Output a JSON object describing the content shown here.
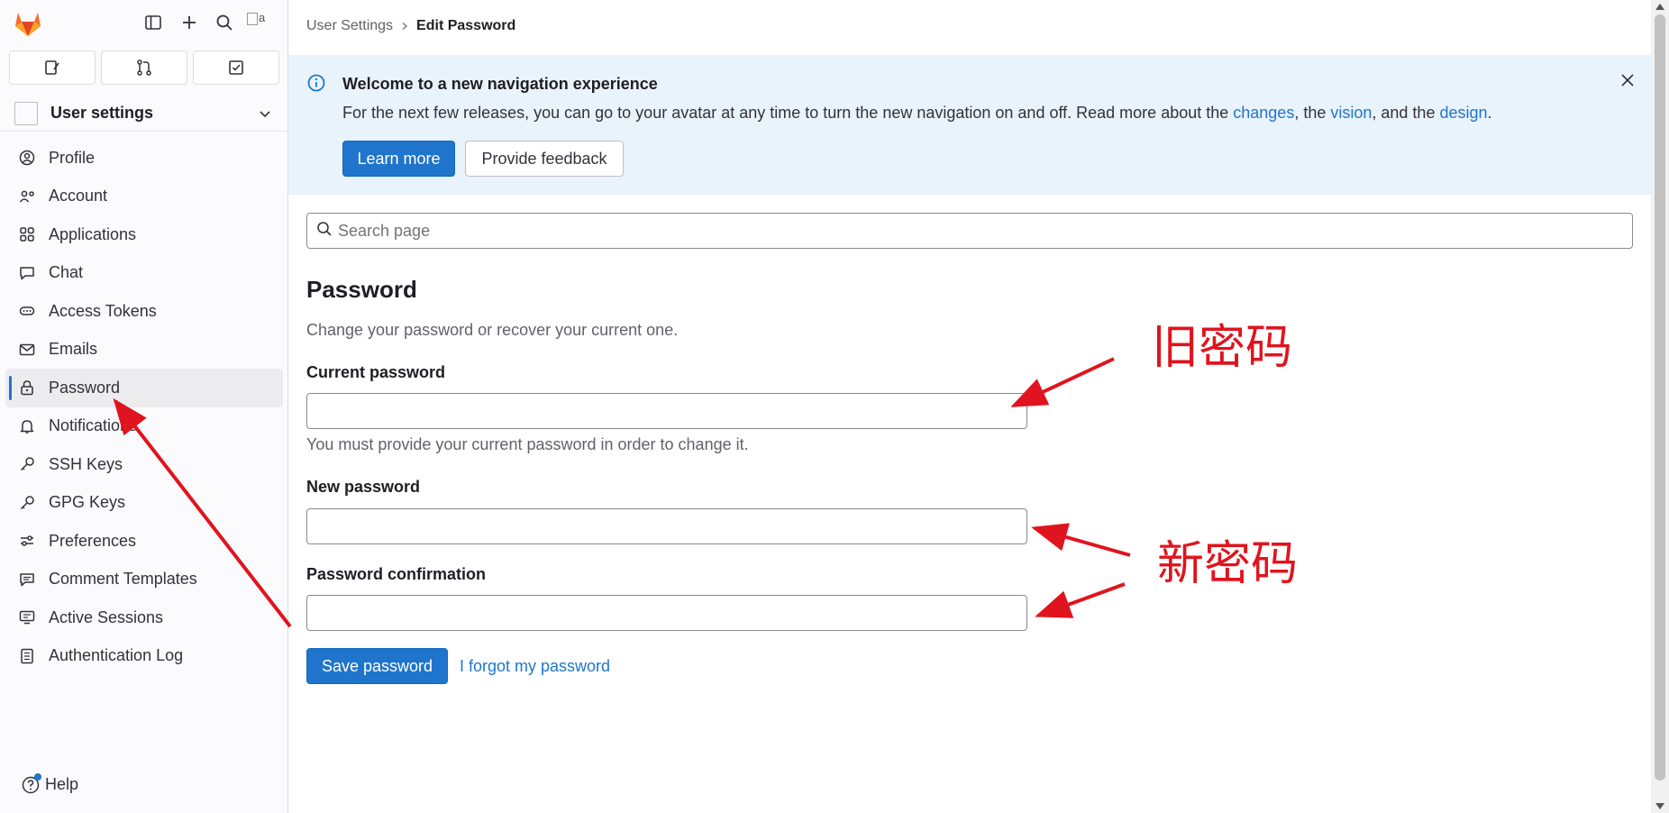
{
  "sidebar": {
    "context_title": "User settings",
    "avatar_alt": "a",
    "items": [
      {
        "label": "Profile",
        "icon": "profile-icon"
      },
      {
        "label": "Account",
        "icon": "account-icon"
      },
      {
        "label": "Applications",
        "icon": "applications-icon"
      },
      {
        "label": "Chat",
        "icon": "chat-icon"
      },
      {
        "label": "Access Tokens",
        "icon": "token-icon"
      },
      {
        "label": "Emails",
        "icon": "mail-icon"
      },
      {
        "label": "Password",
        "icon": "lock-icon",
        "active": true
      },
      {
        "label": "Notifications",
        "icon": "bell-icon"
      },
      {
        "label": "SSH Keys",
        "icon": "key-icon"
      },
      {
        "label": "GPG Keys",
        "icon": "key-icon"
      },
      {
        "label": "Preferences",
        "icon": "preferences-icon"
      },
      {
        "label": "Comment Templates",
        "icon": "comment-icon"
      },
      {
        "label": "Active Sessions",
        "icon": "monitor-icon"
      },
      {
        "label": "Authentication Log",
        "icon": "log-icon"
      }
    ],
    "help_label": "Help"
  },
  "breadcrumb": {
    "parent": "User Settings",
    "current": "Edit Password"
  },
  "banner": {
    "title": "Welcome to a new navigation experience",
    "text_before": "For the next few releases, you can go to your avatar at any time to turn the new navigation on and off. Read more about the ",
    "link_changes": "changes",
    "text_mid1": ", the ",
    "link_vision": "vision",
    "text_mid2": ", and the ",
    "link_design": "design",
    "text_end": ".",
    "learn_more": "Learn more",
    "provide_feedback": "Provide feedback"
  },
  "search": {
    "placeholder": "Search page"
  },
  "form": {
    "heading": "Password",
    "description": "Change your password or recover your current one.",
    "current_label": "Current password",
    "current_value": "",
    "current_hint": "You must provide your current password in order to change it.",
    "new_label": "New password",
    "new_value": "",
    "confirm_label": "Password confirmation",
    "confirm_value": "",
    "save_button": "Save password",
    "forgot_link": "I forgot my password"
  },
  "annotations": {
    "old_password": "旧密码",
    "new_password": "新密码",
    "color": "#e0141e"
  },
  "colors": {
    "primary": "#1f75cb",
    "banner_bg": "#e9f3fc",
    "sidebar_bg": "#fbfafd"
  }
}
